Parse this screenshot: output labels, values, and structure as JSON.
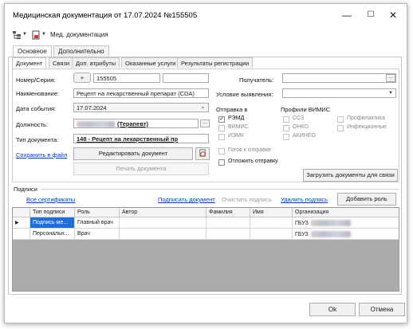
{
  "window": {
    "title": "Медицинская документация от 17.07.2024 №155505",
    "min": "—",
    "max": "☐",
    "close": "✕"
  },
  "toolbar": {
    "label": "Мед. документация"
  },
  "main_tabs": [
    "Основное",
    "Дополнительно"
  ],
  "sub_tabs": [
    "Документ",
    "Связи",
    "Доп. атрибуты",
    "Оказанные услуги",
    "Результаты регистрации"
  ],
  "form": {
    "number_label": "Номер/Серия:",
    "plus": "+",
    "number_value": "155505",
    "name_label": "Наименование:",
    "name_value": "Рецепт на лекарственный препарат (CDA)",
    "date_label": "Дата события:",
    "date_value": "17.07.2024",
    "position_label": "Должность:",
    "position_value": "(Терапевт)",
    "doctype_label": "Тип документа:",
    "doctype_value": "148 - Рецепт на лекарственный пр",
    "recipient_label": "Получатель:",
    "detect_label": "Условие выявления:",
    "save_file_link": "Сохранить в файл",
    "edit_doc_btn": "Редактировать документ",
    "print_doc_btn": "Печать документа"
  },
  "send": {
    "title": "Отправка в",
    "options": [
      {
        "label": "РЭМД",
        "checked": true,
        "enabled": true
      },
      {
        "label": "ВИМИС",
        "checked": false,
        "enabled": false
      },
      {
        "label": "ИЭМК",
        "checked": false,
        "enabled": false
      }
    ],
    "profiles_title": "Профили ВИМИС",
    "profiles": [
      {
        "label": "ССЗ"
      },
      {
        "label": "ОНКО"
      },
      {
        "label": "АКИНЕО"
      },
      {
        "label": "Профилактика"
      },
      {
        "label": "Инфекционные"
      }
    ],
    "ready_label": "Готов к отправке",
    "defer_label": "Отложить отправку",
    "upload_btn": "Загрузить документы для связи"
  },
  "signatures": {
    "section_title": "Подписи",
    "all_certs": "Все сертификаты",
    "sign_link": "Подписать документ",
    "clear_link": "Очистить подпись",
    "delete_link": "Удалить подпись",
    "add_role_btn": "Добавить роль",
    "columns": [
      "Тип подписи",
      "Роль",
      "Автор",
      "Фамилия",
      "Имя",
      "Организация"
    ],
    "rows": [
      {
        "marker": "▶",
        "type": "Подпись ме...",
        "role": "Главный врач",
        "author": "",
        "last": "",
        "first": "",
        "org": "ГБУЗ"
      },
      {
        "marker": "",
        "type": "Персональн...",
        "role": "Врач",
        "author": "",
        "last": "",
        "first": "",
        "org": "ГБУЗ"
      }
    ]
  },
  "footer": {
    "ok": "Ok",
    "cancel": "Отмена"
  }
}
